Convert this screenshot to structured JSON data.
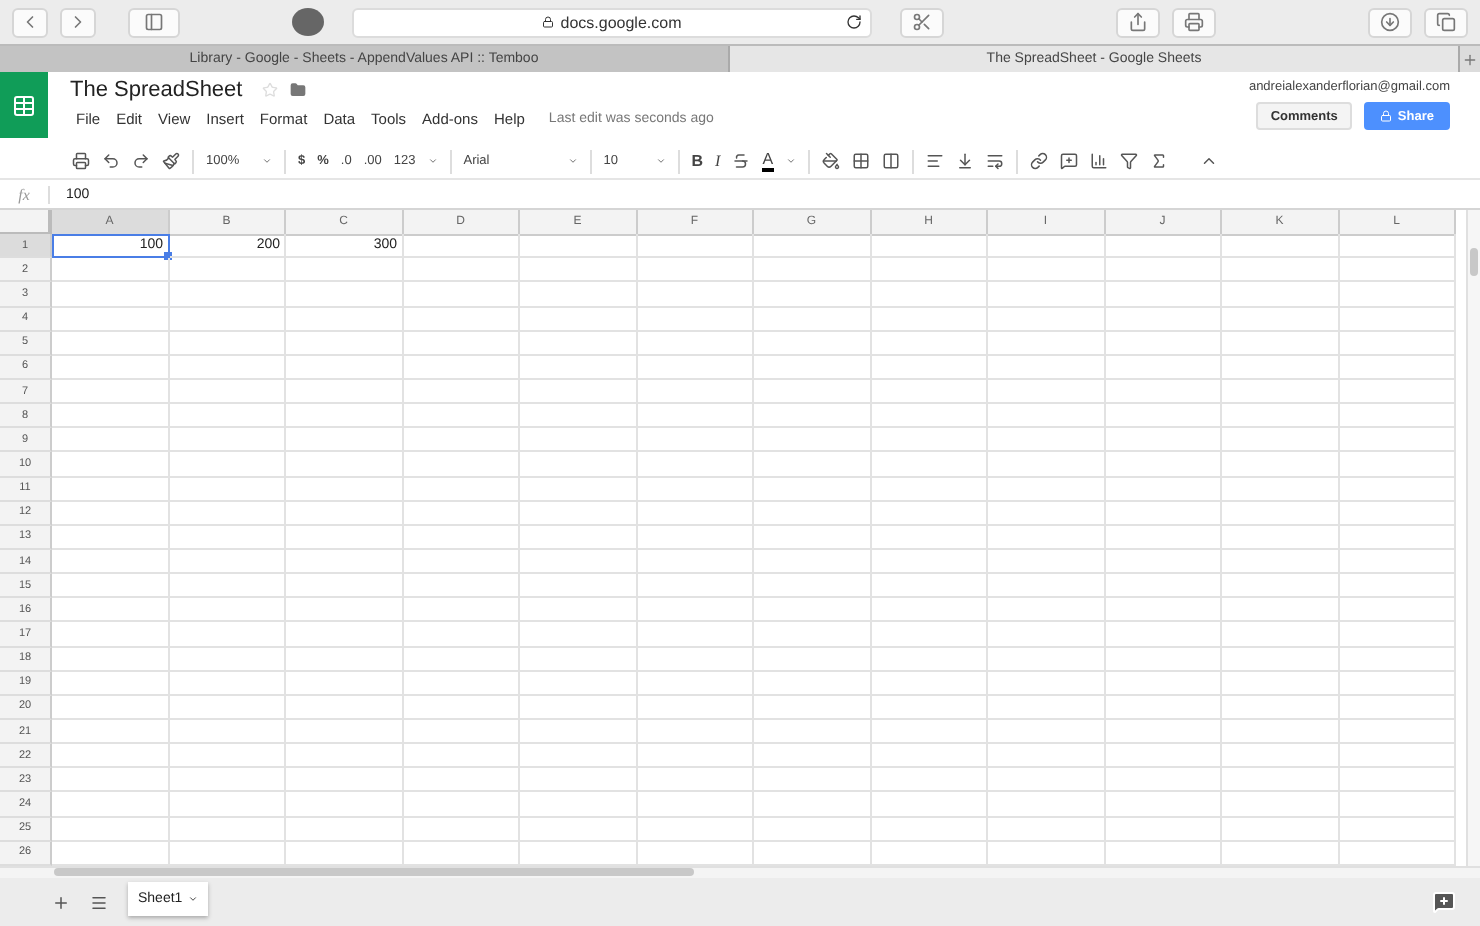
{
  "browser": {
    "url": "docs.google.com",
    "tabs": [
      {
        "label": "Library - Google - Sheets - AppendValues API :: Temboo",
        "selected": false
      },
      {
        "label": "The SpreadSheet - Google Sheets",
        "selected": true
      }
    ]
  },
  "document": {
    "title": "The SpreadSheet",
    "account": "andreialexanderflorian@gmail.com",
    "status": "Last edit was seconds ago",
    "comments_button": "Comments",
    "share_button": "Share"
  },
  "menu": [
    "File",
    "Edit",
    "View",
    "Insert",
    "Format",
    "Data",
    "Tools",
    "Add-ons",
    "Help"
  ],
  "toolbar": {
    "zoom": "100%",
    "currency": "$",
    "percent": "%",
    "decrease_decimals": ".0",
    "increase_decimals": ".00",
    "number_format": "123",
    "font": "Arial",
    "font_size": "10",
    "bold": "B",
    "italic": "I",
    "text_color": "A"
  },
  "formula_bar": {
    "label": "fx",
    "value": "100"
  },
  "columns": [
    {
      "label": "A",
      "selected": true
    },
    {
      "label": "B",
      "selected": false
    },
    {
      "label": "C",
      "selected": false
    },
    {
      "label": "D",
      "selected": false
    },
    {
      "label": "E",
      "selected": false
    },
    {
      "label": "F",
      "selected": false
    },
    {
      "label": "G",
      "selected": false
    },
    {
      "label": "H",
      "selected": false
    },
    {
      "label": "I",
      "selected": false
    },
    {
      "label": "J",
      "selected": false
    },
    {
      "label": "K",
      "selected": false
    },
    {
      "label": "L",
      "selected": false
    }
  ],
  "rows": [
    {
      "label": "1",
      "selected": true,
      "cells": [
        {
          "value": "100",
          "selected": true
        },
        {
          "value": "200",
          "selected": false
        },
        {
          "value": "300",
          "selected": false
        }
      ]
    },
    {
      "label": "2",
      "selected": false
    },
    {
      "label": "3",
      "selected": false
    },
    {
      "label": "4",
      "selected": false
    },
    {
      "label": "5",
      "selected": false
    },
    {
      "label": "6",
      "selected": false
    },
    {
      "label": "7",
      "selected": false
    },
    {
      "label": "8",
      "selected": false
    },
    {
      "label": "9",
      "selected": false
    },
    {
      "label": "10",
      "selected": false
    },
    {
      "label": "11",
      "selected": false
    },
    {
      "label": "12",
      "selected": false
    },
    {
      "label": "13",
      "selected": false
    },
    {
      "label": "14",
      "selected": false
    },
    {
      "label": "15",
      "selected": false
    },
    {
      "label": "16",
      "selected": false
    },
    {
      "label": "17",
      "selected": false
    },
    {
      "label": "18",
      "selected": false
    },
    {
      "label": "19",
      "selected": false
    },
    {
      "label": "20",
      "selected": false
    },
    {
      "label": "21",
      "selected": false
    },
    {
      "label": "22",
      "selected": false
    },
    {
      "label": "23",
      "selected": false
    },
    {
      "label": "24",
      "selected": false
    },
    {
      "label": "25",
      "selected": false
    },
    {
      "label": "26",
      "selected": false
    }
  ],
  "sheet_tabs": [
    {
      "label": "Sheet1",
      "selected": true
    }
  ]
}
